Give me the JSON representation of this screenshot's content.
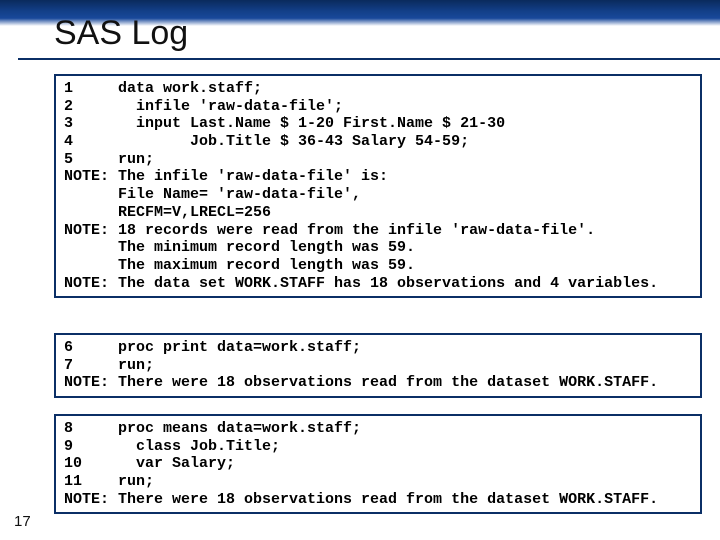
{
  "title": "SAS Log",
  "slide_number": "17",
  "code_blocks": {
    "block1": "1     data work.staff;\n2       infile 'raw-data-file';\n3       input Last.Name $ 1-20 First.Name $ 21-30\n4             Job.Title $ 36-43 Salary 54-59;\n5     run;\nNOTE: The infile 'raw-data-file' is:\n      File Name= 'raw-data-file',\n      RECFM=V,LRECL=256\nNOTE: 18 records were read from the infile 'raw-data-file'.\n      The minimum record length was 59.\n      The maximum record length was 59.\nNOTE: The data set WORK.STAFF has 18 observations and 4 variables.",
    "block2": "6     proc print data=work.staff;\n7     run;\nNOTE: There were 18 observations read from the dataset WORK.STAFF.",
    "block3": "8     proc means data=work.staff;\n9       class Job.Title;\n10      var Salary;\n11    run;\nNOTE: There were 18 observations read from the dataset WORK.STAFF."
  }
}
